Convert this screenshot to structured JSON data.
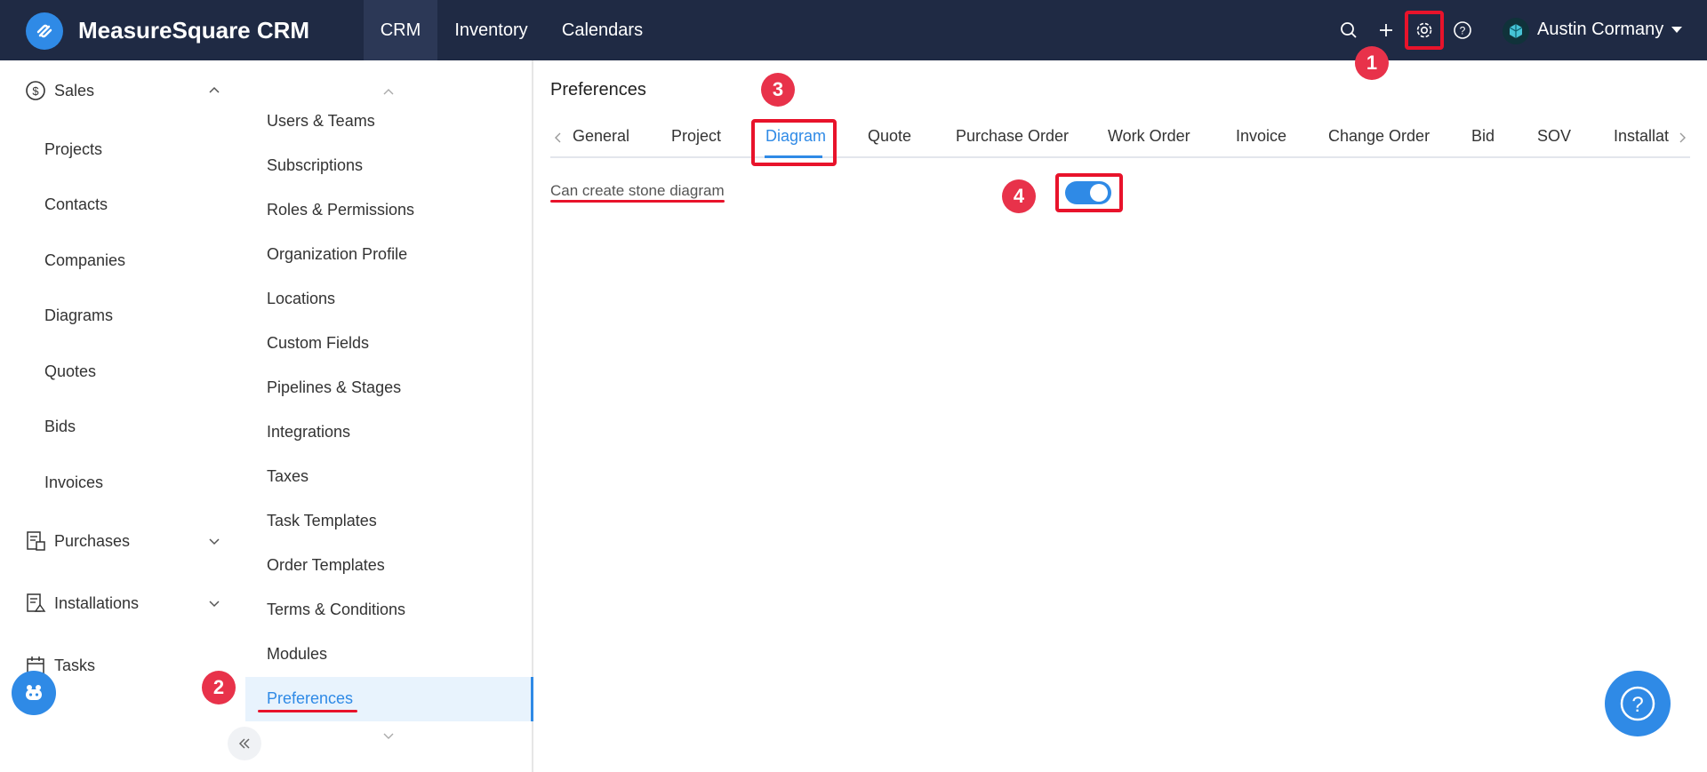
{
  "app": {
    "title": "MeasureSquare CRM"
  },
  "nav": {
    "crm": "CRM",
    "inventory": "Inventory",
    "calendars": "Calendars"
  },
  "user": {
    "name": "Austin Cormany"
  },
  "sidebar": {
    "sales": "Sales",
    "items": [
      "Projects",
      "Contacts",
      "Companies",
      "Diagrams",
      "Quotes",
      "Bids",
      "Invoices"
    ],
    "purchases": "Purchases",
    "installations": "Installations",
    "tasks": "Tasks"
  },
  "settings_menu": {
    "items": [
      "Users & Teams",
      "Subscriptions",
      "Roles & Permissions",
      "Organization Profile",
      "Locations",
      "Custom Fields",
      "Pipelines & Stages",
      "Integrations",
      "Taxes",
      "Task Templates",
      "Order Templates",
      "Terms & Conditions",
      "Modules",
      "Preferences"
    ]
  },
  "content": {
    "title": "Preferences",
    "tabs": [
      "General",
      "Project",
      "Diagram",
      "Quote",
      "Purchase Order",
      "Work Order",
      "Invoice",
      "Change Order",
      "Bid",
      "SOV",
      "Installat"
    ],
    "active_tab": "Diagram",
    "option_label": "Can create stone diagram",
    "option_enabled": true
  },
  "annotations": {
    "b1": "1",
    "b2": "2",
    "b3": "3",
    "b4": "4"
  },
  "colors": {
    "topbar": "#1f2a44",
    "accent": "#2f8ae6",
    "annotation": "#e8132b"
  }
}
